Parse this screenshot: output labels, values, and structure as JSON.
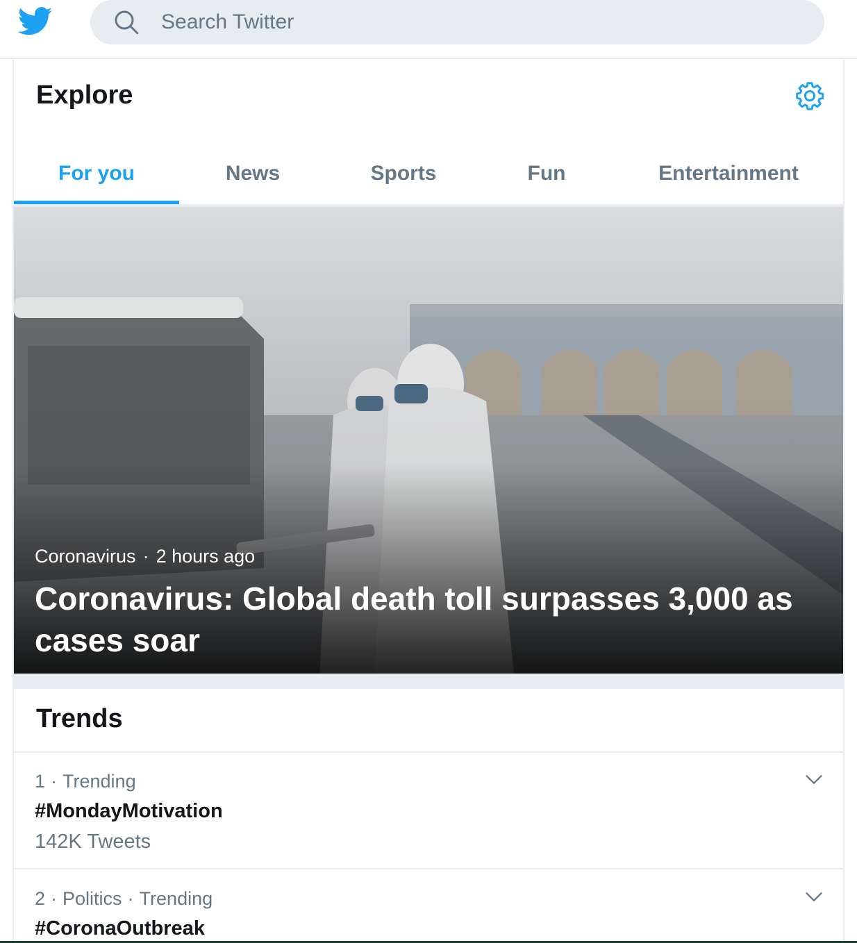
{
  "topbar": {
    "logo_icon": "twitter-bird-icon",
    "search": {
      "placeholder": "Search Twitter",
      "value": "",
      "icon": "search-icon"
    }
  },
  "explore": {
    "title": "Explore",
    "settings_icon": "gear-icon",
    "tabs": [
      {
        "label": "For you",
        "active": true
      },
      {
        "label": "News",
        "active": false
      },
      {
        "label": "Sports",
        "active": false
      },
      {
        "label": "Fun",
        "active": false
      },
      {
        "label": "Entertainment",
        "active": false
      }
    ]
  },
  "hero": {
    "category": "Coronavirus",
    "separator": "·",
    "time": "2 hours ago",
    "headline": "Coronavirus: Global death toll surpasses 3,000 as cases soar"
  },
  "trends": {
    "title": "Trends",
    "items": [
      {
        "rank": "1",
        "sep": "·",
        "context": "Trending",
        "name": "#MondayMotivation",
        "count": "142K Tweets"
      },
      {
        "rank": "2",
        "sep": "·",
        "category": "Politics",
        "sep2": "·",
        "context": "Trending",
        "name": "#CoronaOutbreak"
      }
    ]
  },
  "colors": {
    "accent": "#1da1f2",
    "secondary_text": "#657786",
    "primary_text": "#14171a",
    "divider": "#e6ecf0"
  }
}
